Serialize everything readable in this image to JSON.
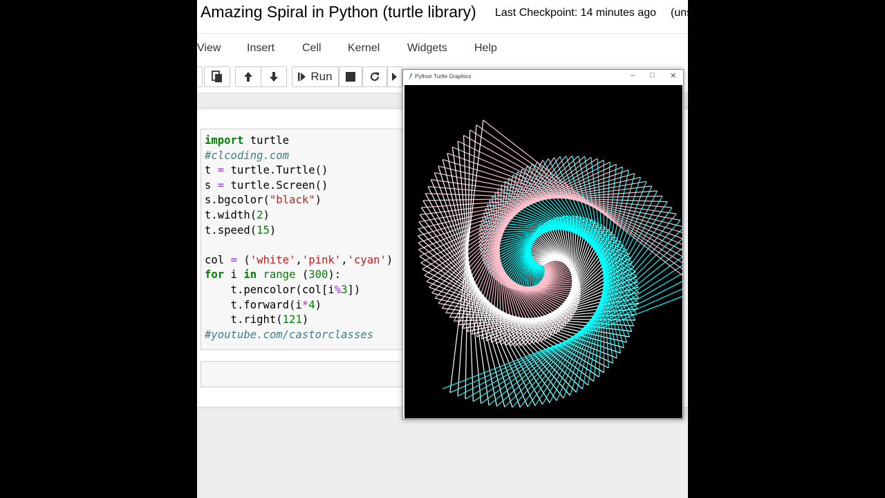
{
  "header": {
    "title": "Amazing Spiral in Python (turtle library)",
    "checkpoint": "Last Checkpoint: 14 minutes ago",
    "unsaved": "(uns"
  },
  "menu": [
    "View",
    "Insert",
    "Cell",
    "Kernel",
    "Widgets",
    "Help"
  ],
  "toolbar": {
    "run_label": "Run",
    "icons": [
      "paste-icon",
      "arrow-up-icon",
      "arrow-down-icon",
      "step-icon",
      "stop-icon",
      "restart-icon",
      "fast-forward-icon"
    ]
  },
  "code_cell": {
    "lines": [
      "import turtle",
      "#clcoding.com",
      "t = turtle.Turtle()",
      "s = turtle.Screen()",
      "s.bgcolor(\"black\")",
      "t.width(2)",
      "t.speed(15)",
      "",
      "col = ('white','pink','cyan')",
      "for i in range (300):",
      "    t.pencolor(col[i%3])",
      "    t.forward(i*4)",
      "    t.right(121)",
      "#youtube.com/castorclasses"
    ]
  },
  "turtle_window": {
    "title": "Python Turtle Graphics",
    "background": "#000000",
    "pen_colors": [
      "#ffffff",
      "#ffc0cb",
      "#00ffff"
    ],
    "drawing": {
      "steps": 300,
      "step_multiplier": 4,
      "turn_angle": 121
    }
  }
}
